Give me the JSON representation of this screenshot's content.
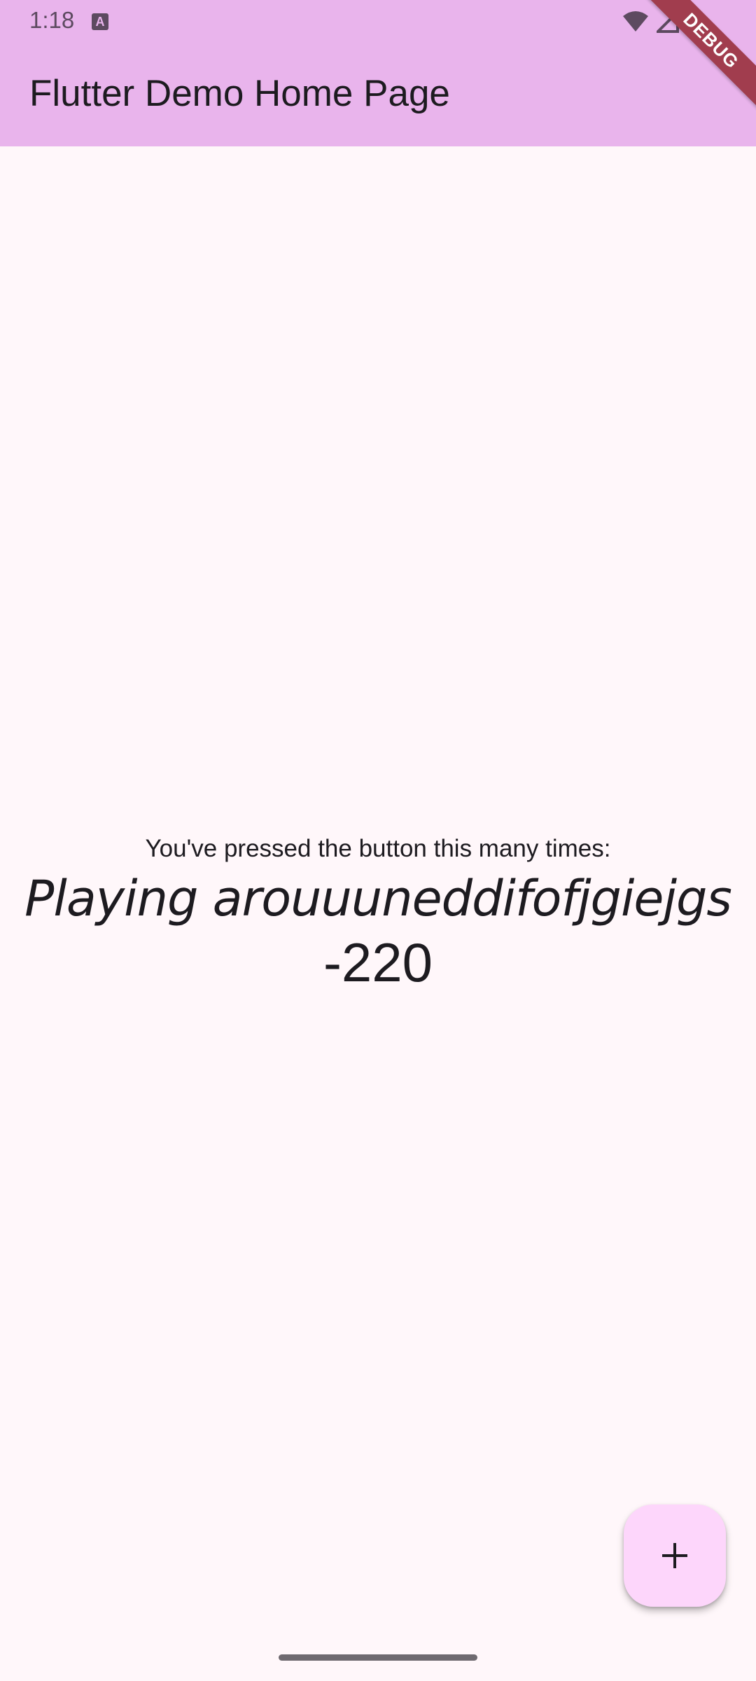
{
  "status_bar": {
    "time": "1:18",
    "notification_icon_label": "A",
    "icons": [
      "wifi-icon",
      "cell-signal-icon",
      "battery-icon"
    ]
  },
  "app_bar": {
    "title": "Flutter Demo Home Page"
  },
  "debug_banner": {
    "label": "DEBUG"
  },
  "main": {
    "caption": "You've pressed the button this many times:",
    "playing_text": "Playing arouuuneddifofjgiejgs",
    "counter_value": "-220"
  },
  "fab": {
    "icon": "plus-icon"
  },
  "colors": {
    "app_bar_bg": "#e9b4ec",
    "page_bg": "#fff7fa",
    "fab_bg": "#fdd6fb",
    "debug_banner": "#a13d4e",
    "text": "#1d1b20"
  }
}
